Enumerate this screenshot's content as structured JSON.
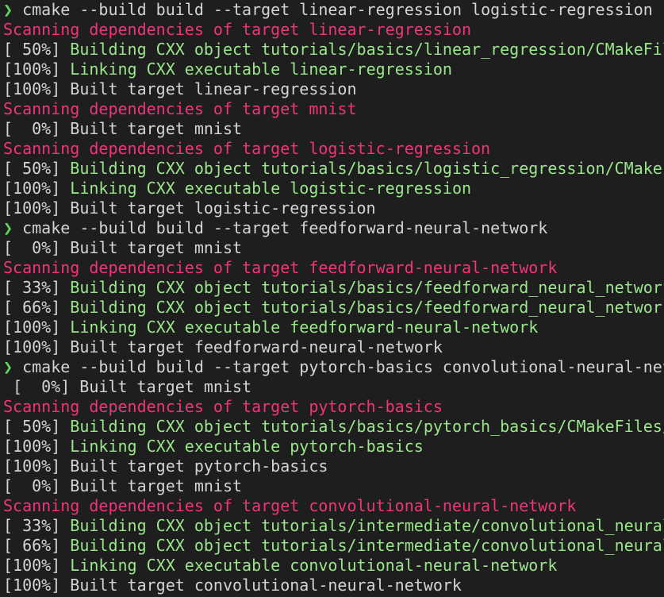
{
  "colors": {
    "background": "#1e1e1e",
    "prompt": "#5fd75f",
    "scanning": "#f0347a",
    "green_text": "#9ae68a",
    "default_text": "#d4d4d4"
  },
  "prompt_symbol": "❯",
  "lines": [
    {
      "kind": "cmd",
      "text": "cmake --build build --target linear-regression logistic-regression"
    },
    {
      "kind": "scan",
      "text": "Scanning dependencies of target linear-regression"
    },
    {
      "kind": "green",
      "prefix": "[ 50%] ",
      "text": "Building CXX object tutorials/basics/linear_regression/CMakeFil"
    },
    {
      "kind": "green",
      "prefix": "[100%] ",
      "text": "Linking CXX executable linear-regression"
    },
    {
      "kind": "plain",
      "text": "[100%] Built target linear-regression"
    },
    {
      "kind": "scan",
      "text": "Scanning dependencies of target mnist"
    },
    {
      "kind": "plain",
      "text": "[  0%] Built target mnist"
    },
    {
      "kind": "scan",
      "text": "Scanning dependencies of target logistic-regression"
    },
    {
      "kind": "green",
      "prefix": "[ 50%] ",
      "text": "Building CXX object tutorials/basics/logistic_regression/CMakeF"
    },
    {
      "kind": "green",
      "prefix": "[100%] ",
      "text": "Linking CXX executable logistic-regression"
    },
    {
      "kind": "plain",
      "text": "[100%] Built target logistic-regression"
    },
    {
      "kind": "cmd",
      "text": "cmake --build build --target feedforward-neural-network"
    },
    {
      "kind": "plain",
      "text": "[  0%] Built target mnist"
    },
    {
      "kind": "scan",
      "text": "Scanning dependencies of target feedforward-neural-network"
    },
    {
      "kind": "green",
      "prefix": "[ 33%] ",
      "text": "Building CXX object tutorials/basics/feedforward_neural_network"
    },
    {
      "kind": "green",
      "prefix": "[ 66%] ",
      "text": "Building CXX object tutorials/basics/feedforward_neural_network"
    },
    {
      "kind": "green",
      "prefix": "[100%] ",
      "text": "Linking CXX executable feedforward-neural-network"
    },
    {
      "kind": "plain",
      "text": "[100%] Built target feedforward-neural-network"
    },
    {
      "kind": "cmd",
      "text": "cmake --build build --target pytorch-basics convolutional-neural-net"
    },
    {
      "kind": "plain-indent",
      "text": "[  0%] Built target mnist"
    },
    {
      "kind": "scan",
      "text": "Scanning dependencies of target pytorch-basics"
    },
    {
      "kind": "green",
      "prefix": "[ 50%] ",
      "text": "Building CXX object tutorials/basics/pytorch_basics/CMakeFiles/"
    },
    {
      "kind": "green",
      "prefix": "[100%] ",
      "text": "Linking CXX executable pytorch-basics"
    },
    {
      "kind": "plain",
      "text": "[100%] Built target pytorch-basics"
    },
    {
      "kind": "plain",
      "text": "[  0%] Built target mnist"
    },
    {
      "kind": "scan",
      "text": "Scanning dependencies of target convolutional-neural-network"
    },
    {
      "kind": "green",
      "prefix": "[ 33%] ",
      "text": "Building CXX object tutorials/intermediate/convolutional_neural"
    },
    {
      "kind": "green",
      "prefix": "[ 66%] ",
      "text": "Building CXX object tutorials/intermediate/convolutional_neural"
    },
    {
      "kind": "green",
      "prefix": "[100%] ",
      "text": "Linking CXX executable convolutional-neural-network"
    },
    {
      "kind": "plain",
      "text": "[100%] Built target convolutional-neural-network"
    }
  ]
}
